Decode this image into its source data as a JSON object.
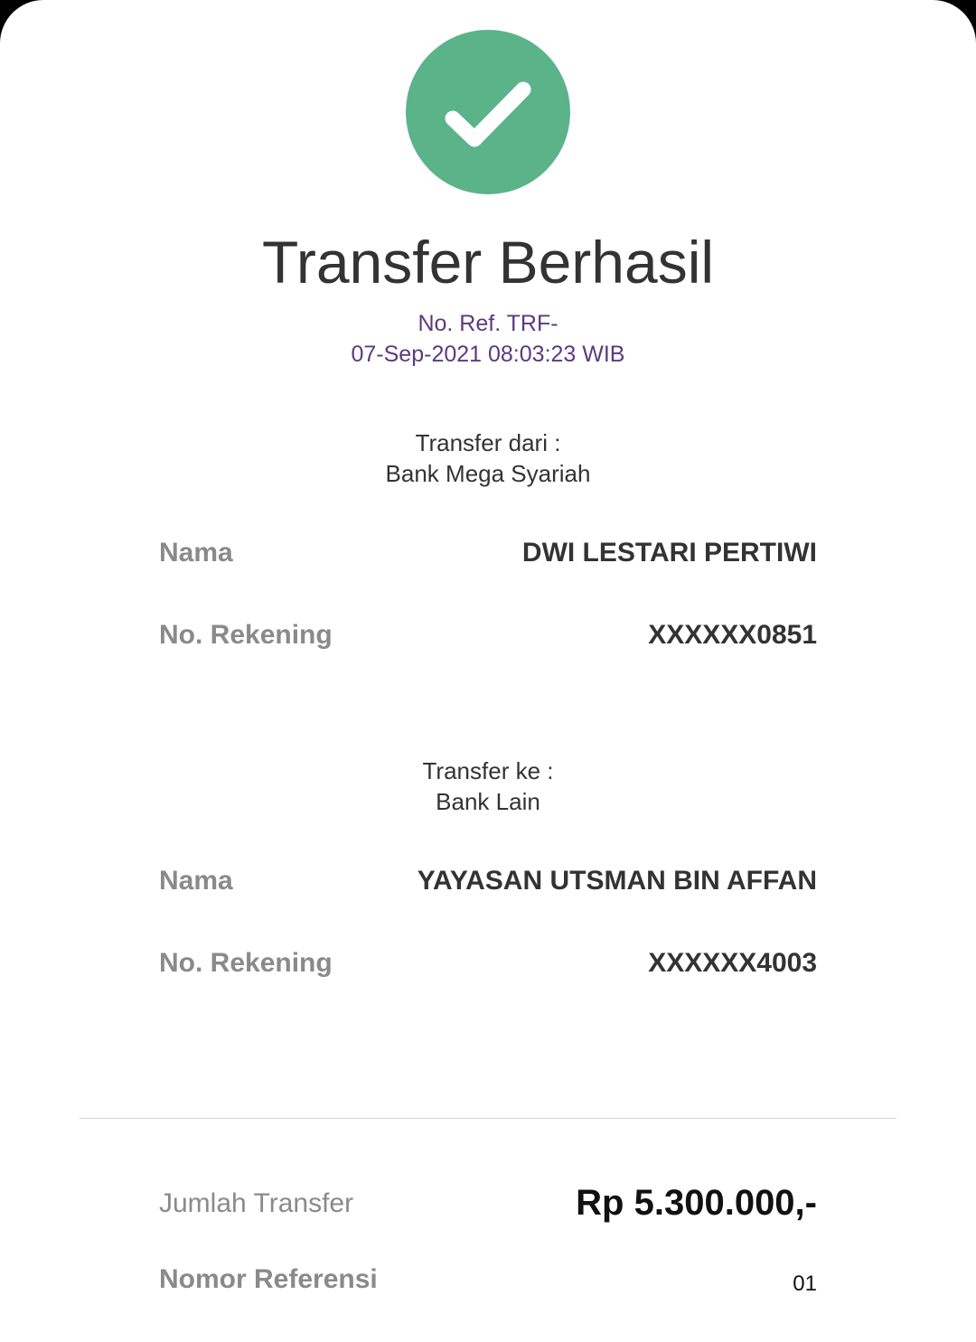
{
  "status": {
    "icon": "checkmark-icon",
    "color": "#5bb38a",
    "title": "Transfer Berhasil",
    "ref_line1": "No. Ref. TRF-",
    "ref_line2": "07-Sep-2021 08:03:23 WIB"
  },
  "from": {
    "heading": "Transfer dari :",
    "bank": "Bank Mega Syariah",
    "name_label": "Nama",
    "name_value": "DWI LESTARI PERTIWI",
    "account_label": "No. Rekening",
    "account_value": "XXXXXX0851"
  },
  "to": {
    "heading": "Transfer ke :",
    "bank": "Bank Lain",
    "name_label": "Nama",
    "name_value": "YAYASAN UTSMAN BIN AFFAN",
    "account_label": "No. Rekening",
    "account_value": "XXXXXX4003"
  },
  "summary": {
    "amount_label": "Jumlah Transfer",
    "amount_value": "Rp 5.300.000,-",
    "ref_label": "Nomor Referensi",
    "ref_value": "01"
  }
}
